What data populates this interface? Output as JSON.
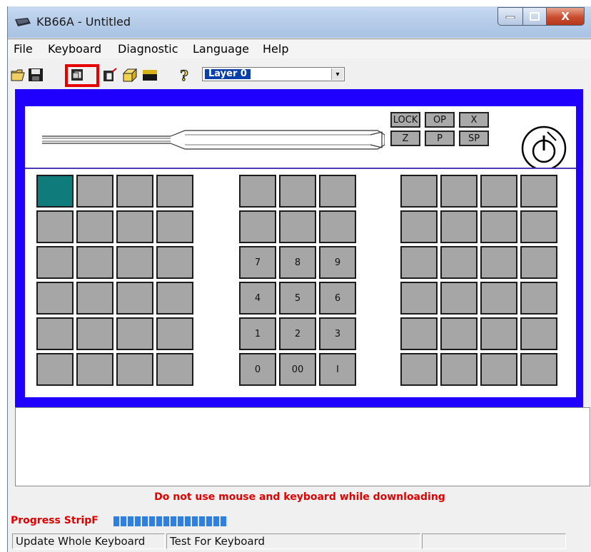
{
  "window": {
    "title": "KB66A - Untitled",
    "close_glyph": "X"
  },
  "menu": [
    "File",
    "Keyboard",
    "Diagnostic",
    "Language",
    "Help"
  ],
  "toolbar": {
    "icons": [
      "open-icon",
      "save-icon",
      "copy-layer-icon",
      "paste-layer-icon",
      "3d-box-icon",
      "bar-icon",
      "help-icon"
    ],
    "layer_select": {
      "value": "Layer 0",
      "arrow": "▾"
    }
  },
  "slot_buttons": [
    {
      "id": "lock",
      "label": "LOCK"
    },
    {
      "id": "op",
      "label": "OP"
    },
    {
      "id": "x",
      "label": "X"
    },
    {
      "id": "z",
      "label": "Z"
    },
    {
      "id": "p",
      "label": "P"
    },
    {
      "id": "sp",
      "label": "SP"
    }
  ],
  "keypad_labels": [
    [
      "",
      "",
      ""
    ],
    [
      "",
      "",
      ""
    ],
    [
      "7",
      "8",
      "9"
    ],
    [
      "4",
      "5",
      "6"
    ],
    [
      "1",
      "2",
      "3"
    ],
    [
      "0",
      "00",
      "I"
    ]
  ],
  "messages": {
    "warning": "Do not use mouse and keyboard while downloading"
  },
  "progress": {
    "label": "Progress StripF",
    "percent": 100
  },
  "status": {
    "left": "Update Whole Keyboard",
    "middle": "Test For Keyboard",
    "right": ""
  },
  "colors": {
    "frame": "#1f00ff",
    "selected_key": "#0f7b7b",
    "key": "#a6a6a6",
    "warning": "#e00000"
  }
}
